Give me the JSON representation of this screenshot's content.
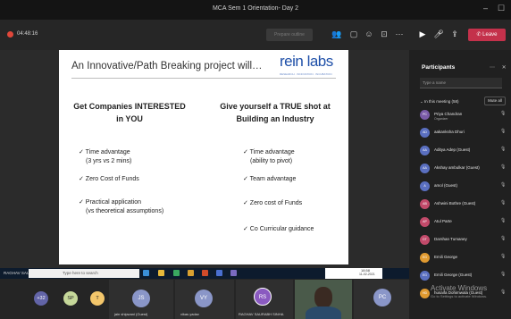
{
  "window": {
    "title": "MCA Sem 1 Orientation- Day 2",
    "minimize": "–",
    "maximize": "☐"
  },
  "toolbar": {
    "timer": "04:48:16",
    "prepare_label": "Prepare outline",
    "leave_label": "Leave"
  },
  "slide": {
    "title": "An Innovative/Path Breaking project will…",
    "logo": "rein labs",
    "logo_tagline": "RESEARCH · INNOVATION · INCUBATION",
    "left_heading": "Get Companies INTERESTED in YOU",
    "right_heading": "Give yourself a TRUE shot at Building an Industry",
    "left_points": [
      "✓ Time advantage",
      "(3 yrs vs 2 mins)",
      "✓ Zero Cost of Funds",
      "✓ Practical application",
      "(vs theoretical assumptions)"
    ],
    "right_points": [
      "✓ Time advantage",
      "(ability to pivot)",
      "✓ Team advantage",
      "✓ Zero cost of Funds",
      "✓ Co Curricular guidance"
    ]
  },
  "taskbar": {
    "presenter": "RAGHAV SAURABH SINHA",
    "search_text": "Type here to search",
    "time": "18:58",
    "date": "11-02-2021",
    "lang": "ENG"
  },
  "strip": {
    "more_count": "+32",
    "avatars": [
      "SP",
      "T"
    ],
    "tiles": [
      {
        "initials": "JS",
        "name": "jain shipwani (Guest)"
      },
      {
        "initials": "VY",
        "name": "vikas yadav"
      },
      {
        "initials": "RS",
        "name": "RAGHAV SAURABH SINHA"
      },
      {
        "initials": "PC",
        "name": ""
      }
    ]
  },
  "participants": {
    "title": "Participants",
    "search_placeholder": "Type a name",
    "in_meeting": "In this meeting (58)",
    "mute_all": "Mute all",
    "list": [
      {
        "initials": "PC",
        "name": "Priya Chandran",
        "role": "Organizer",
        "color": "#7a5ba8"
      },
      {
        "initials": "AD",
        "name": "aakanksha Dhuri",
        "role": "",
        "color": "#5a6fc0"
      },
      {
        "initials": "AA",
        "name": "Aditya Adep (Guest)",
        "role": "",
        "color": "#5a6fc0"
      },
      {
        "initials": "AA",
        "name": "Akshay ambulkar (Guest)",
        "role": "",
        "color": "#5a6fc0"
      },
      {
        "initials": "A",
        "name": "amol (Guest)",
        "role": "",
        "color": "#5a6fc0"
      },
      {
        "initials": "AB",
        "name": "Ashwini Bothre (Guest)",
        "role": "",
        "color": "#c24a6a"
      },
      {
        "initials": "AP",
        "name": "Atul Parte",
        "role": "",
        "color": "#c24a6a"
      },
      {
        "initials": "DT",
        "name": "Darshan Tumaney",
        "role": "",
        "color": "#c24a6a"
      },
      {
        "initials": "EG",
        "name": "Emili George",
        "role": "",
        "color": "#e09a30"
      },
      {
        "initials": "EG",
        "name": "Emili George (Guest)",
        "role": "",
        "color": "#5a6fc0"
      },
      {
        "initials": "HD",
        "name": "husaifa Dohimwala (Guest)",
        "role": "",
        "color": "#e09a30"
      }
    ]
  },
  "watermark": {
    "line1": "Activate Windows",
    "line2": "Go to Settings to activate Windows."
  },
  "colors": {
    "leave": "#c4314b",
    "accent": "#6264a7",
    "logo": "#1e4fa8"
  }
}
